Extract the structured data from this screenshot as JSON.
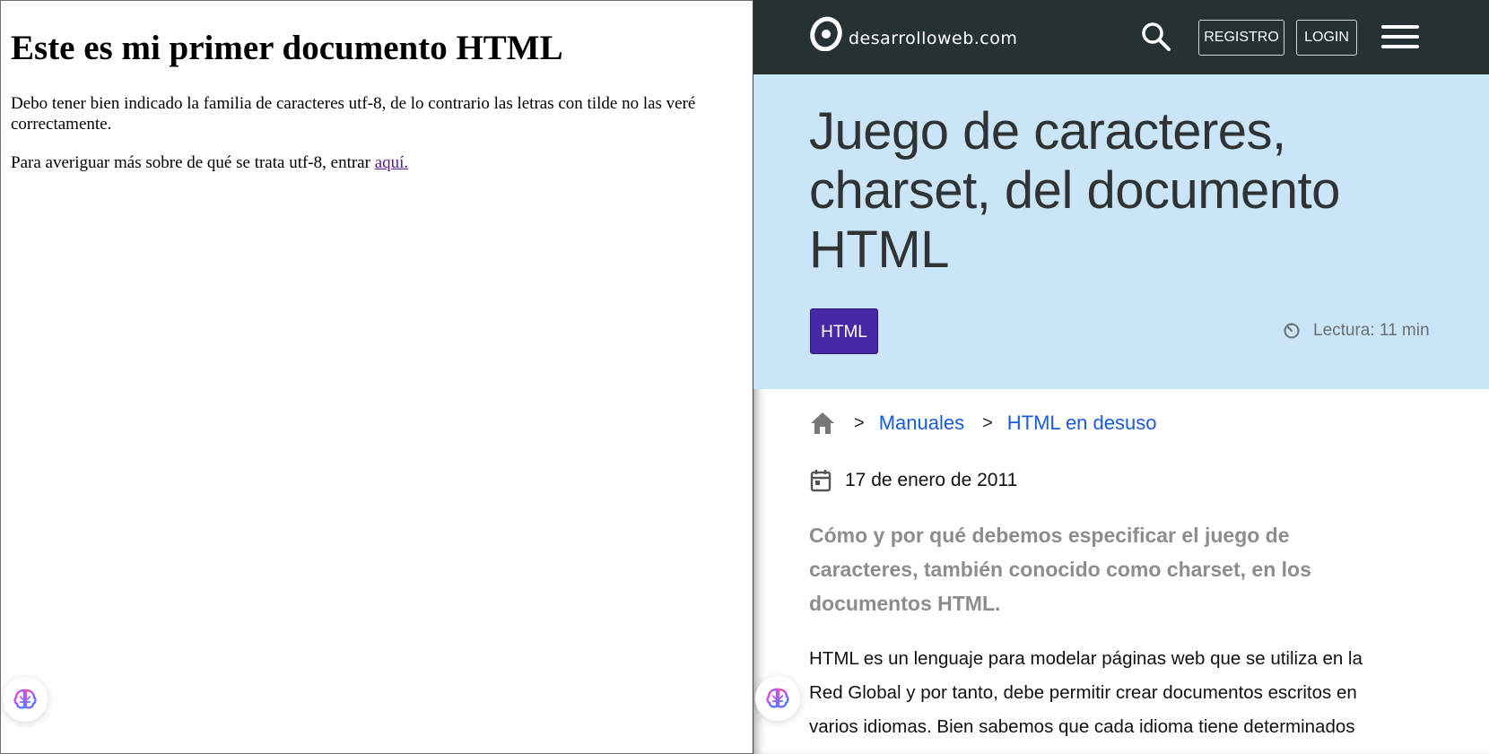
{
  "left": {
    "heading": "Este es mi primer documento HTML",
    "paragraph1": "Debo tener bien indicado la familia de caracteres utf-8, de lo contrario las letras con tilde no las veré correctamente.",
    "paragraph2_prefix": "Para averiguar más sobre de qué se trata utf-8, entrar ",
    "link_text": "aquí."
  },
  "site": {
    "logo_text": "desarrolloweb.com",
    "registro_label": "REGISTRO",
    "login_label": "LOGIN",
    "icons": [
      "logo-icon",
      "search-icon",
      "menu-icon",
      "clock-icon",
      "home-icon",
      "calendar-icon",
      "brain-icon"
    ]
  },
  "article": {
    "title": "Juego de caracteres, charset, del documento HTML",
    "tag": "HTML",
    "reading_time": "Lectura: 11 min",
    "breadcrumb": [
      "Manuales",
      "HTML en desuso"
    ],
    "breadcrumb_separator": ">",
    "date": "17 de enero de 2011",
    "lead": "Cómo y por qué debemos especificar el juego de caracteres, también conocido como charset, en los documentos HTML.",
    "body": "HTML es un lenguaje para modelar páginas web que se utiliza en la Red Global y por tanto, debe permitir crear documentos escritos en varios idiomas. Bien sabemos que cada idioma tiene determinados"
  },
  "colors": {
    "topbar": "#263131",
    "hero": "#cae5f8",
    "tag": "#4627a4",
    "link": "#1a5bd8",
    "visited_link": "#551a8b"
  }
}
